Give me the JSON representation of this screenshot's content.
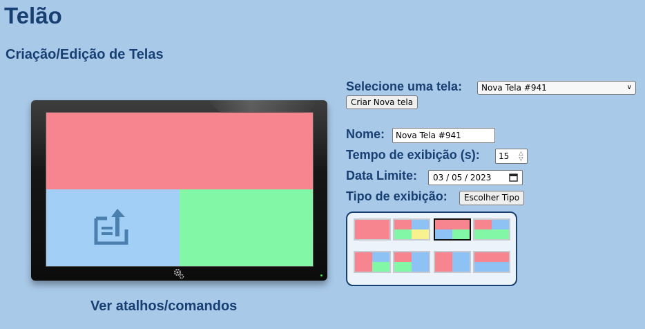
{
  "page": {
    "title": "Telão",
    "subtitle": "Criação/Edição de Telas"
  },
  "preview": {
    "shortcuts_link": "Ver atalhos/comandos",
    "upload_icon": "upload-document-icon",
    "gear_icon": "gear-icon"
  },
  "form": {
    "select_label": "Selecione uma tela:",
    "select_value": "Nova Tela #941",
    "create_button": "Criar Nova tela",
    "name_label": "Nome:",
    "name_value": "Nova Tela #941",
    "time_label": "Tempo de exibição (s):",
    "time_value": "15",
    "date_label": "Data Limite:",
    "date_value": "03 / 05 / 2023",
    "type_label": "Tipo de exibição:",
    "type_button": "Escolher Tipo"
  },
  "colors": {
    "background": "#a9c9e9",
    "heading": "#173f72",
    "zone_red": "#f7858f",
    "zone_blue": "#a1cff5",
    "zone_green": "#82f7a5",
    "zone_yellow": "#f7f28e"
  },
  "layout_options": [
    "single",
    "grid-4",
    "top-split-bottom",
    "split-top-bottom",
    "left-right-split",
    "left-split-right",
    "two-columns",
    "two-rows"
  ],
  "selected_layout": "top-split-bottom"
}
